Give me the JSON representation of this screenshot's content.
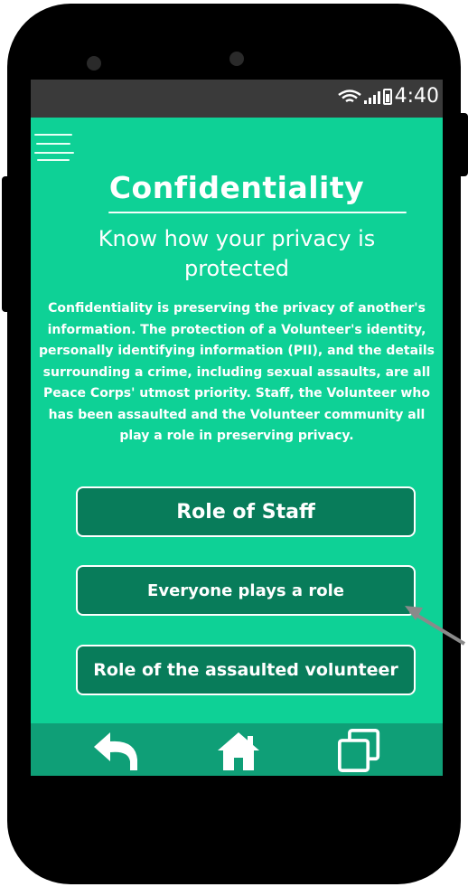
{
  "status_bar": {
    "time": "4:40"
  },
  "screen": {
    "title": "Confidentiality",
    "subtitle": "Know how your privacy is protected",
    "body": "Confidentiality is preserving the privacy of another's information. The protection of a Volunteer's identity, personally identifying information  (PII), and the details surrounding a crime, including sexual assaults, are all Peace Corps' utmost priority.  Staff, the Volunteer who has been assaulted and the Volunteer community all play a role in preserving privacy.",
    "buttons": [
      {
        "label": "Role of Staff"
      },
      {
        "label": "Everyone plays a role"
      },
      {
        "label": "Role of the assaulted volunteer"
      }
    ]
  },
  "nav": {
    "items": [
      {
        "icon": "back-icon"
      },
      {
        "icon": "home-icon"
      },
      {
        "icon": "recent-apps-icon"
      }
    ]
  },
  "colors": {
    "screen_bg": "#0ed196",
    "button_bg": "#087c5a",
    "nav_bg": "#0f9f77",
    "status_bg": "#3a3a3a"
  }
}
